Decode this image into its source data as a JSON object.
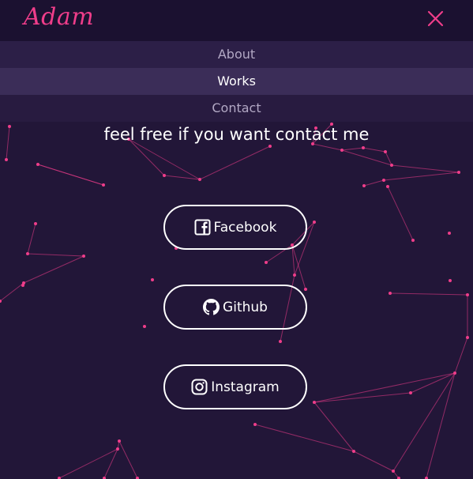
{
  "brand": {
    "logo_text": "Adam",
    "accent_color": "#ef3d8a"
  },
  "header": {
    "close_icon": "close-icon"
  },
  "nav": {
    "items": [
      {
        "label": "About",
        "active": false
      },
      {
        "label": "Works",
        "active": true
      },
      {
        "label": "Contact",
        "active": false
      }
    ]
  },
  "contact": {
    "tagline": "feel free if you want contact me",
    "buttons": [
      {
        "label": "Facebook",
        "icon": "facebook-icon"
      },
      {
        "label": "Github",
        "icon": "github-icon"
      },
      {
        "label": "Instagram",
        "icon": "instagram-icon"
      }
    ]
  },
  "colors": {
    "background": "#221638",
    "header_background": "#1b1130",
    "nav_item_background": "#2c1f47",
    "nav_item_active_background": "#3b2d58",
    "text": "#ffffff"
  }
}
